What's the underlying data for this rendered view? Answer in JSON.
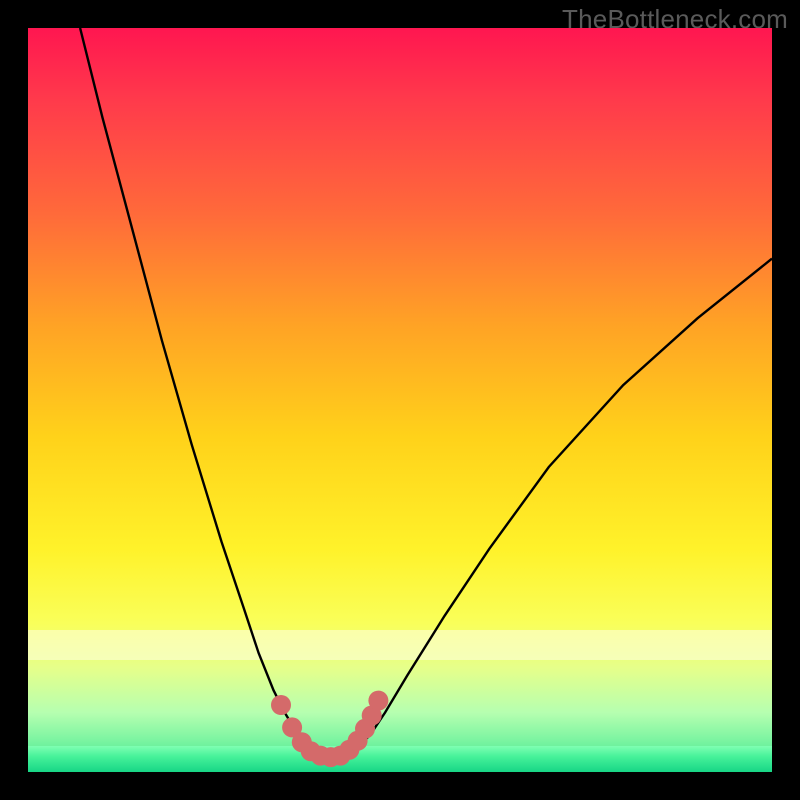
{
  "watermark": "TheBottleneck.com",
  "colors": {
    "curve": "#000000",
    "dots": "#d46a6a",
    "dot_stroke": "#c85a5a"
  },
  "chart_data": {
    "type": "line",
    "title": "",
    "xlabel": "",
    "ylabel": "",
    "xlim": [
      0,
      100
    ],
    "ylim": [
      0,
      100
    ],
    "series": [
      {
        "name": "left-branch",
        "x": [
          7,
          10,
          14,
          18,
          22,
          26,
          29,
          31,
          33,
          34.5,
          36,
          37,
          38,
          38.8
        ],
        "y": [
          100,
          88,
          73,
          58,
          44,
          31,
          22,
          16,
          11,
          8,
          5.5,
          4,
          3,
          2.3
        ]
      },
      {
        "name": "bottom",
        "x": [
          38.8,
          40,
          41.5,
          43
        ],
        "y": [
          2.3,
          2,
          2,
          2.3
        ]
      },
      {
        "name": "right-branch",
        "x": [
          43,
          44.5,
          46,
          48,
          51,
          56,
          62,
          70,
          80,
          90,
          100
        ],
        "y": [
          2.3,
          3.5,
          5,
          8,
          13,
          21,
          30,
          41,
          52,
          61,
          69
        ]
      }
    ],
    "dots": {
      "name": "highlight-dots",
      "points": [
        {
          "x": 34.0,
          "y": 9.0
        },
        {
          "x": 35.5,
          "y": 6.0
        },
        {
          "x": 36.8,
          "y": 4.0
        },
        {
          "x": 38.0,
          "y": 2.8
        },
        {
          "x": 39.3,
          "y": 2.2
        },
        {
          "x": 40.7,
          "y": 2.0
        },
        {
          "x": 42.0,
          "y": 2.2
        },
        {
          "x": 43.2,
          "y": 3.0
        },
        {
          "x": 44.3,
          "y": 4.2
        },
        {
          "x": 45.3,
          "y": 5.8
        },
        {
          "x": 46.2,
          "y": 7.6
        },
        {
          "x": 47.1,
          "y": 9.6
        }
      ],
      "radius": 10
    }
  }
}
